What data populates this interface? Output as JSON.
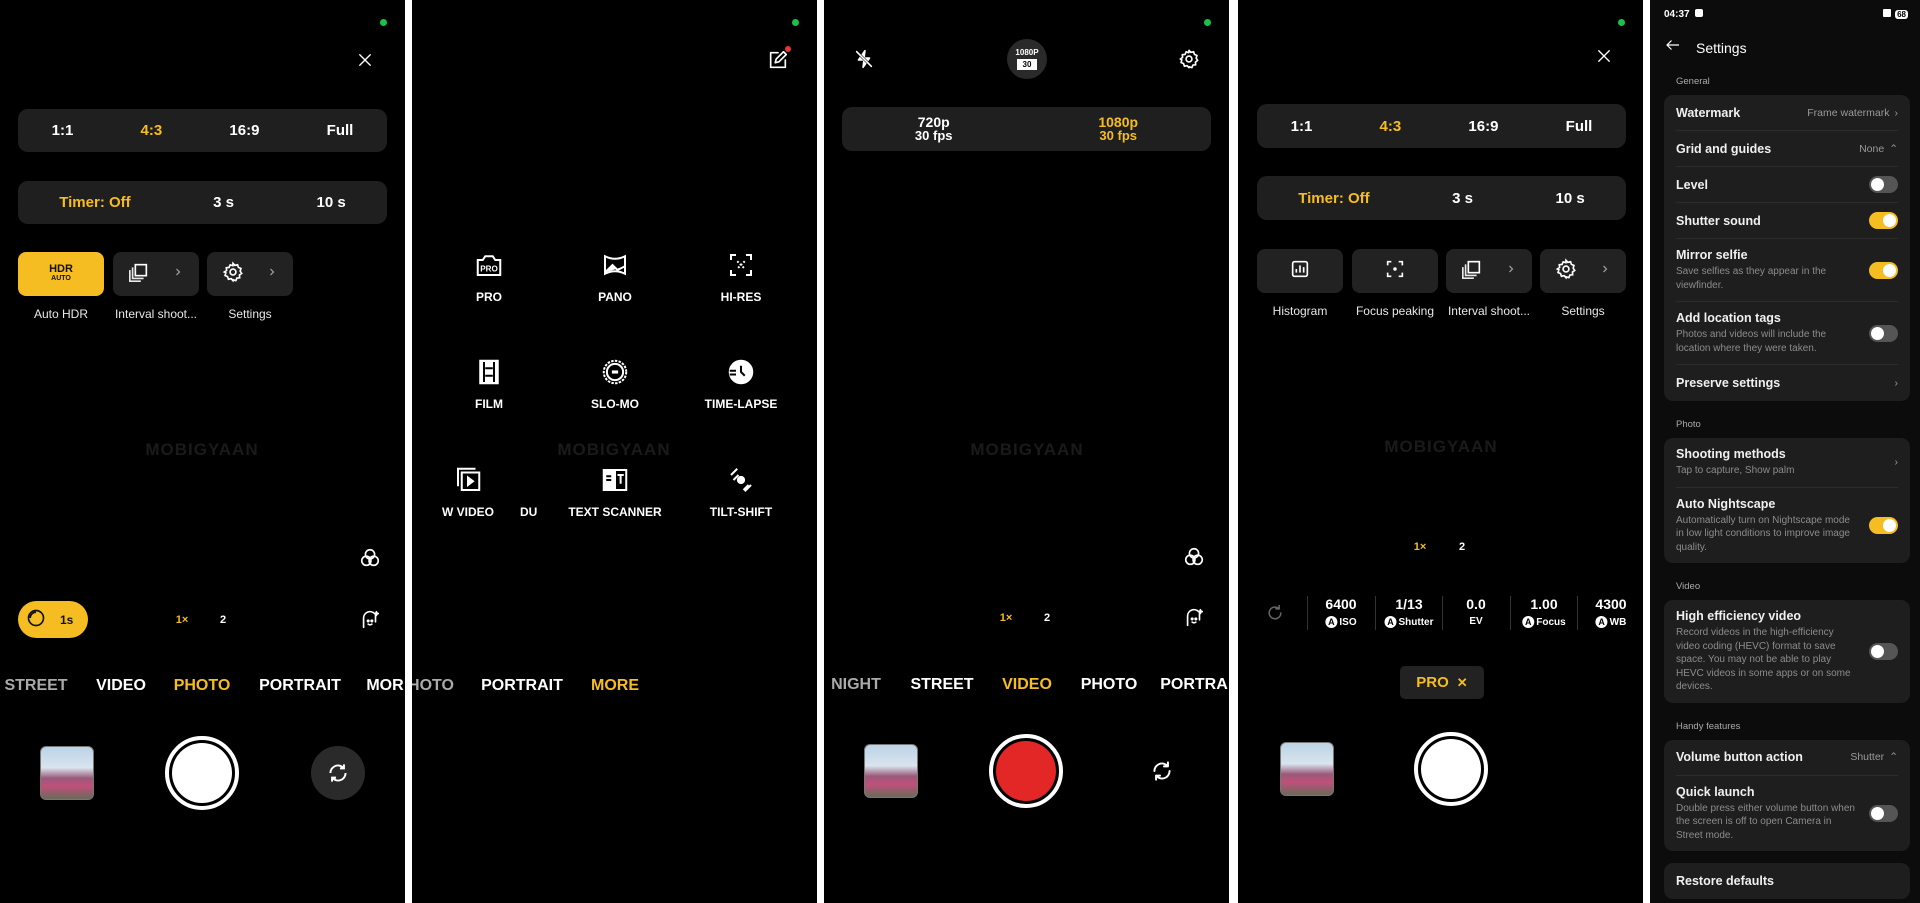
{
  "accent": "#f6bd22",
  "watermark_text": "MOBIGYAAN",
  "panel1": {
    "aspect": [
      "1:1",
      "4:3",
      "16:9",
      "Full"
    ],
    "aspect_selected": 1,
    "timer": [
      "Timer: Off",
      "3 s",
      "10 s"
    ],
    "timer_selected": 0,
    "quick": [
      {
        "icon": "hdr-auto-icon",
        "label": "Auto HDR",
        "hdr_top": "HDR",
        "hdr_bottom": "AUTO"
      },
      {
        "icon": "interval-shooting-icon",
        "label": "Interval shoot..."
      },
      {
        "icon": "gear-icon",
        "label": "Settings"
      }
    ],
    "exposure_pill": "1s",
    "zoom": [
      "1×",
      "2"
    ],
    "modes": [
      "STREET",
      "VIDEO",
      "PHOTO",
      "PORTRAIT",
      "MOR"
    ],
    "mode_selected": 2
  },
  "panel2": {
    "grid": [
      {
        "label": "PRO",
        "icon": "pro-camera-icon",
        "icon_text": "PRO"
      },
      {
        "label": "PANO",
        "icon": "panorama-icon"
      },
      {
        "label": "HI-RES",
        "icon": "hi-res-icon"
      },
      {
        "label": "FILM",
        "icon": "film-icon"
      },
      {
        "label": "SLO-MO",
        "icon": "slow-motion-icon"
      },
      {
        "label": "TIME-LAPSE",
        "icon": "time-lapse-icon"
      },
      {
        "label": "W VIDEO",
        "icon": "dual-video-icon"
      },
      {
        "label": "TEXT SCANNER",
        "icon": "text-scanner-icon"
      },
      {
        "label": "TILT-SHIFT",
        "icon": "tilt-shift-icon"
      }
    ],
    "partial_label": "DU",
    "modes": [
      "HOTO",
      "PORTRAIT",
      "MORE"
    ],
    "mode_selected": 2
  },
  "panel3": {
    "res_badge_top": "1080P",
    "res_badge_bottom": "30",
    "resolutions": [
      {
        "res": "720p",
        "fps": "30 fps"
      },
      {
        "res": "1080p",
        "fps": "30 fps"
      }
    ],
    "res_selected": 1,
    "zoom": [
      "1×",
      "2"
    ],
    "modes": [
      "NIGHT",
      "STREET",
      "VIDEO",
      "PHOTO",
      "PORTRA"
    ],
    "mode_selected": 2,
    "record_color": "#e32626"
  },
  "panel4": {
    "aspect": [
      "1:1",
      "4:3",
      "16:9",
      "Full"
    ],
    "aspect_selected": 1,
    "timer": [
      "Timer: Off",
      "3 s",
      "10 s"
    ],
    "timer_selected": 0,
    "quick": [
      {
        "icon": "histogram-icon",
        "label": "Histogram"
      },
      {
        "icon": "focus-peaking-icon",
        "label": "Focus peaking"
      },
      {
        "icon": "interval-shooting-icon",
        "label": "Interval shoot..."
      },
      {
        "icon": "gear-icon",
        "label": "Settings"
      }
    ],
    "zoom": [
      "1×",
      "2"
    ],
    "pro_values": [
      {
        "value": "6400",
        "label": "ISO",
        "auto": "A"
      },
      {
        "value": "1/13",
        "label": "Shutter",
        "auto": "A"
      },
      {
        "value": "0.0",
        "label": "EV"
      },
      {
        "value": "1.00",
        "label": "Focus",
        "auto": "A"
      },
      {
        "value": "4300",
        "label": "WB",
        "auto": "A"
      }
    ],
    "pro_pill": "PRO",
    "pro_close": "✕"
  },
  "settings": {
    "status_time": "04:37",
    "battery": "68",
    "title": "Settings",
    "sections": [
      {
        "name": "General",
        "cards": [
          [
            {
              "title": "Watermark",
              "value": "Frame watermark",
              "control": "chevron"
            },
            {
              "title": "Grid and guides",
              "value": "None",
              "control": "updown"
            },
            {
              "title": "Level",
              "control": "toggle",
              "on": false
            },
            {
              "title": "Shutter sound",
              "control": "toggle",
              "on": true
            },
            {
              "title": "Mirror selfie",
              "sub": "Save selfies as they appear in the viewfinder.",
              "control": "toggle",
              "on": true
            },
            {
              "title": "Add location tags",
              "sub": "Photos and videos will include the location where they were taken.",
              "control": "toggle",
              "on": false
            },
            {
              "title": "Preserve settings",
              "control": "chevron"
            }
          ]
        ]
      },
      {
        "name": "Photo",
        "cards": [
          [
            {
              "title": "Shooting methods",
              "sub": "Tap to capture, Show palm",
              "control": "chevron"
            },
            {
              "title": "Auto Nightscape",
              "sub": "Automatically turn on Nightscape mode in low light conditions to improve image quality.",
              "control": "toggle",
              "on": true
            }
          ]
        ]
      },
      {
        "name": "Video",
        "cards": [
          [
            {
              "title": "High efficiency video",
              "sub": "Record videos in the high-efficiency video coding (HEVC) format to save space. You may not be able to play HEVC videos in some apps or on some devices.",
              "control": "toggle",
              "on": false
            }
          ]
        ]
      },
      {
        "name": "Handy features",
        "cards": [
          [
            {
              "title": "Volume button action",
              "value": "Shutter",
              "control": "updown"
            },
            {
              "title": "Quick launch",
              "sub": "Double press either volume button when the screen is off to open Camera in Street mode.",
              "control": "toggle",
              "on": false
            }
          ]
        ],
        "extra_card": {
          "title": "Restore defaults"
        }
      }
    ]
  }
}
